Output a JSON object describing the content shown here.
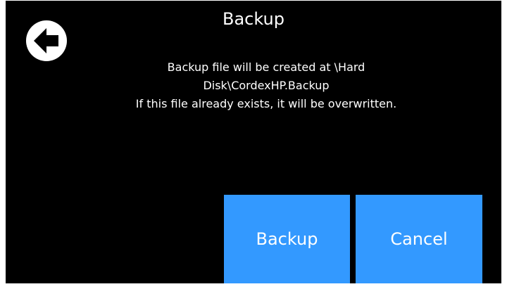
{
  "dialog": {
    "title": "Backup",
    "message_lines": [
      "Backup file will be created at \\Hard",
      "Disk\\CordexHP.Backup",
      "If this file already exists, it will be overwritten."
    ]
  },
  "buttons": {
    "backup_label": "Backup",
    "cancel_label": "Cancel"
  },
  "icons": {
    "back": "back-arrow-icon"
  },
  "colors": {
    "background": "#000000",
    "button": "#3399ff",
    "text": "#ffffff"
  }
}
